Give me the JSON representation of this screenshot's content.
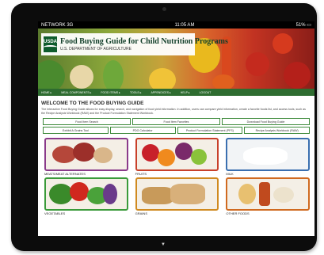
{
  "statusbar": {
    "network": "NETWORK 3G",
    "time": "11:05 AM",
    "battery": "51%"
  },
  "header": {
    "logo_text": "USDA",
    "title": "Food Buying Guide for Child Nutrition Programs",
    "agency": "U.S. DEPARTMENT OF AGRICULTURE"
  },
  "nav": {
    "items": [
      "HOME ▸",
      "MEAL COMPONENTS ▸",
      "FOOD ITEMS ▸",
      "TOOLS ▸",
      "APPENDICES ▸",
      "HELP ▸",
      "LOGOUT"
    ]
  },
  "main": {
    "heading": "WELCOME TO THE FOOD BUYING GUIDE",
    "intro": "The Interactive Food Buying Guide allows for easy display, search, and navigation of food yield information. In addition, users can compare yield information, create a favorite foods list, and access tools, such as the Recipe Analysis Workbook (RAW) and the Product Formulation Statement Workbook.",
    "tools_row1": [
      "Food Item Search",
      "Food Item Favorites",
      "Download Food Buying Guide"
    ],
    "tools_row2": [
      "Exhibit A Grains Tool",
      "PDG Calculator",
      "Product Formulation Statement (PFS)",
      "Recipe Analysis Workbook (RAW)"
    ],
    "categories": [
      {
        "label": "MEATS/MEAT ALTERNATES",
        "border": "#8a3a8a"
      },
      {
        "label": "FRUITS",
        "border": "#c8402a"
      },
      {
        "label": "MILK",
        "border": "#3a6fb0"
      },
      {
        "label": "VEGETABLES",
        "border": "#3a9a3a"
      },
      {
        "label": "GRAINS",
        "border": "#d08a20"
      },
      {
        "label": "OTHER FOODS",
        "border": "#d06a20"
      }
    ]
  }
}
